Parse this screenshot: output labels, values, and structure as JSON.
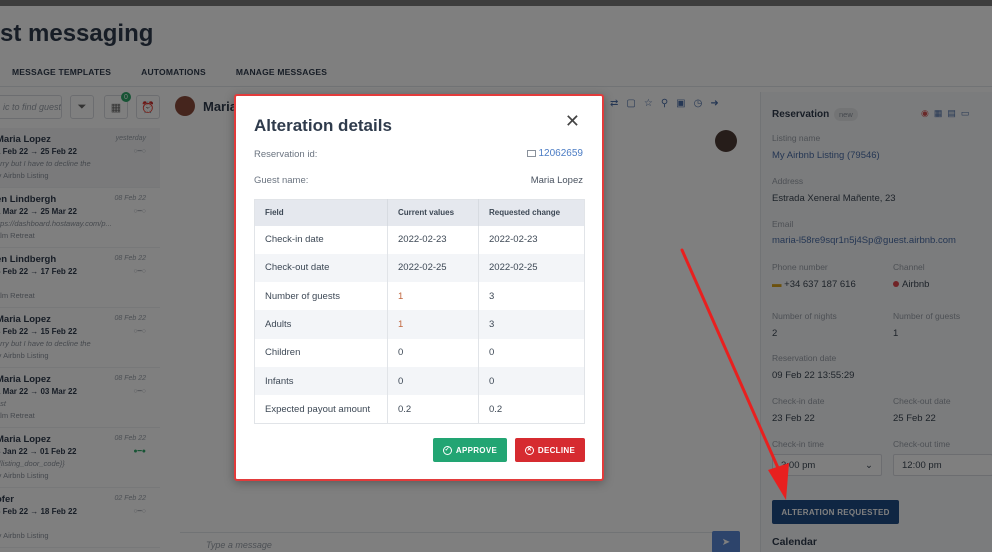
{
  "app": {
    "page_title": "st messaging",
    "tabs": [
      "MESSAGE TEMPLATES",
      "AUTOMATIONS",
      "MANAGE MESSAGES"
    ],
    "search_placeholder": "ic to find guest",
    "calendar_badge": "0",
    "conversations": [
      {
        "name": "Maria Lopez",
        "time": "yesterday",
        "dates": "1 Feb 22 → 25 Feb 22",
        "preview": "orry but I have to decline the",
        "listing": "ly Airbnb Listing",
        "active": true,
        "toggle_on": false
      },
      {
        "name": "en Lindbergh",
        "time": "08 Feb 22",
        "dates": "1 Mar 22 → 25 Mar 22",
        "preview": "ttps://dashboard.hostaway.com/p...",
        "listing": "alm Retreat",
        "active": false,
        "toggle_on": false
      },
      {
        "name": "en Lindbergh",
        "time": "08 Feb 22",
        "dates": "5 Feb 22 → 17 Feb 22",
        "preview": "",
        "listing": "alm Retreat",
        "active": false,
        "toggle_on": false
      },
      {
        "name": "Maria Lopez",
        "time": "08 Feb 22",
        "dates": "3 Feb 22 → 15 Feb 22",
        "preview": "orry but I have to decline the",
        "listing": "ly Airbnb Listing",
        "active": false,
        "toggle_on": false
      },
      {
        "name": "Maria Lopez",
        "time": "08 Feb 22",
        "dates": "1 Mar 22 → 03 Mar 22",
        "preview": "est",
        "listing": "alm Retreat",
        "active": false,
        "toggle_on": false
      },
      {
        "name": "Maria Lopez",
        "time": "08 Feb 22",
        "dates": "8 Jan 22 → 01 Feb 22",
        "preview": "{{listing_door_code}}",
        "listing": "ly Airbnb Listing",
        "active": false,
        "toggle_on": true
      },
      {
        "name": "ofer",
        "time": "02 Feb 22",
        "dates": "6 Feb 22 → 18 Feb 22",
        "preview": "",
        "listing": "ly Airbnb Listing",
        "active": false,
        "toggle_on": false
      }
    ],
    "chat_name": "Maria",
    "message_placeholder": "Type a message",
    "reservation_panel": {
      "title": "Reservation",
      "badge": "new",
      "listing_name_label": "Listing name",
      "listing_name": "My Airbnb Listing  (79546)",
      "address_label": "Address",
      "address": "Estrada Xeneral Mañente, 23",
      "email_label": "Email",
      "email": "maria-l58re9sqr1n5j4Sp@guest.airbnb.com",
      "phone_label": "Phone number",
      "phone": "+34 637 187 616",
      "channel_label": "Channel",
      "channel": "Airbnb",
      "nights_label": "Number of nights",
      "nights": "2",
      "guests_label": "Number of guests",
      "guests": "1",
      "reservation_date_label": "Reservation date",
      "reservation_date": "09 Feb 22 13:55:29",
      "checkin_date_label": "Check-in date",
      "checkin_date": "23 Feb 22",
      "checkout_date_label": "Check-out date",
      "checkout_date": "25 Feb 22",
      "checkin_time_label": "Check-in time",
      "checkin_time": "3:00 pm",
      "checkout_time_label": "Check-out time",
      "checkout_time": "12:00 pm",
      "alteration_button": "ALTERATION REQUESTED",
      "calendar_label": "Calendar"
    }
  },
  "modal": {
    "title": "Alteration details",
    "close_label": "✕",
    "reservation_id_label": "Reservation id:",
    "reservation_id": "12062659",
    "guest_name_label": "Guest name:",
    "guest_name": "Maria Lopez",
    "table": {
      "headers": [
        "Field",
        "Current values",
        "Requested change"
      ],
      "rows": [
        {
          "field": "Check-in date",
          "current": "2022-02-23",
          "requested": "2022-02-23",
          "changed": false
        },
        {
          "field": "Check-out date",
          "current": "2022-02-25",
          "requested": "2022-02-25",
          "changed": false
        },
        {
          "field": "Number of guests",
          "current": "1",
          "requested": "3",
          "changed": true
        },
        {
          "field": "Adults",
          "current": "1",
          "requested": "3",
          "changed": true
        },
        {
          "field": "Children",
          "current": "0",
          "requested": "0",
          "changed": false
        },
        {
          "field": "Infants",
          "current": "0",
          "requested": "0",
          "changed": false
        },
        {
          "field": "Expected payout amount",
          "current": "0.2",
          "requested": "0.2",
          "changed": false
        }
      ]
    },
    "approve_label": "APPROVE",
    "decline_label": "DECLINE"
  },
  "colors": {
    "approve": "#22a573",
    "decline": "#d62b30",
    "annotation_arrow": "#e8201f",
    "alteration_button": "#1e4c86"
  }
}
